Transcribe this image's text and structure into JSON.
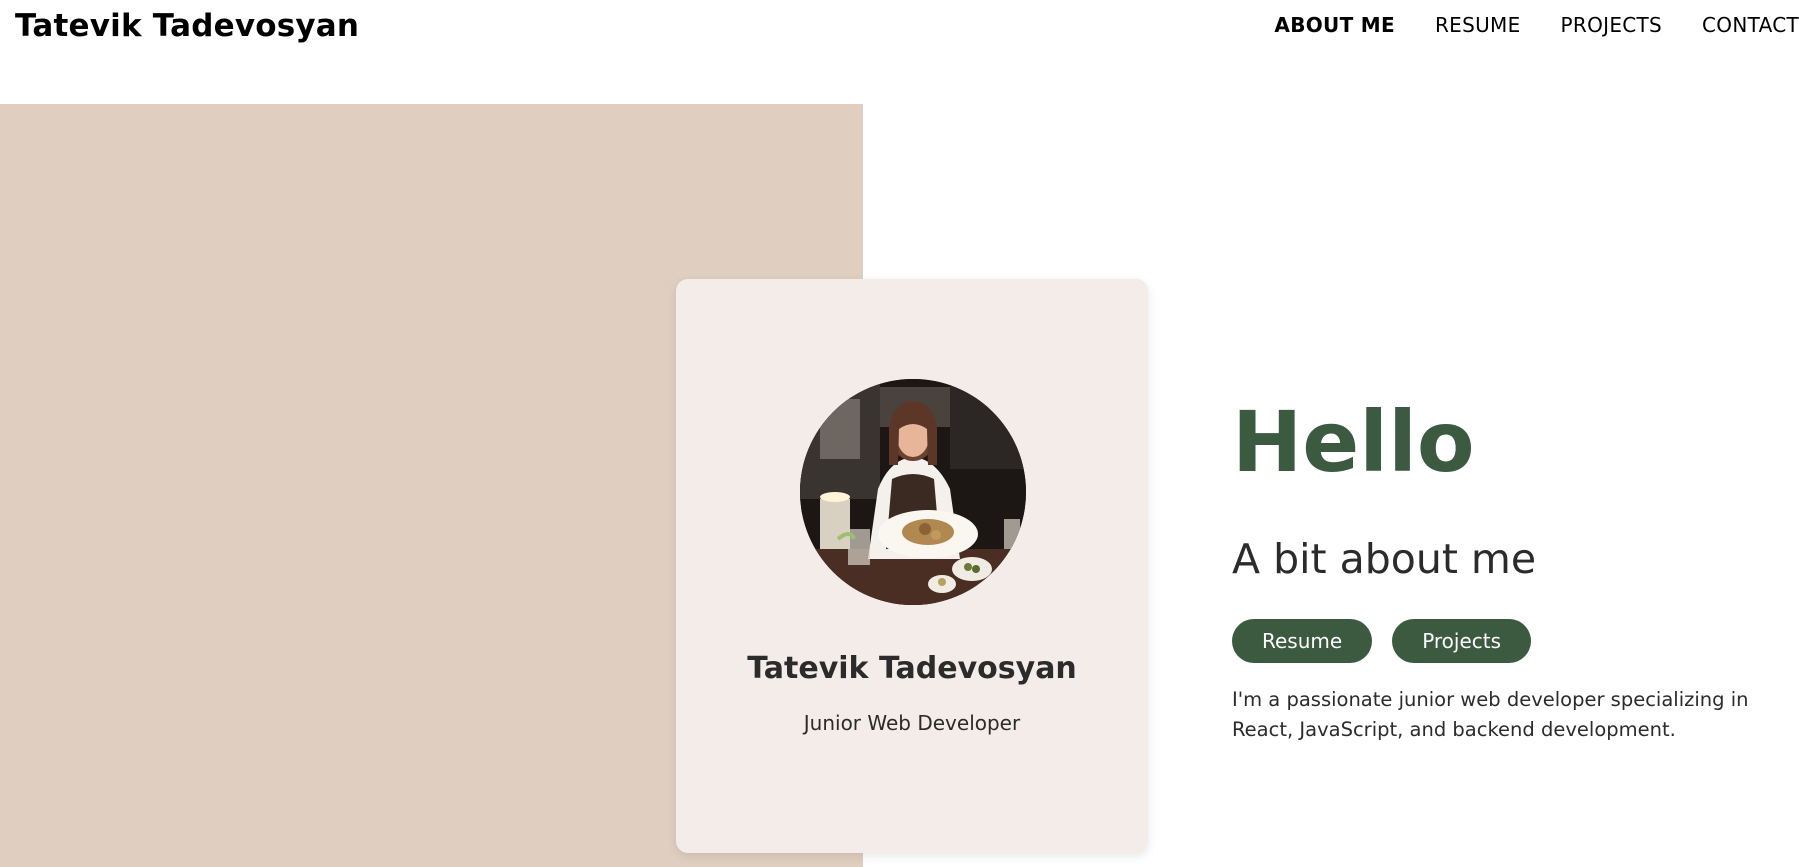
{
  "header": {
    "site_title": "Tatevik Tadevosyan",
    "nav": [
      {
        "label": "ABOUT ME",
        "active": true
      },
      {
        "label": "RESUME",
        "active": false
      },
      {
        "label": "PROJECTS",
        "active": false
      },
      {
        "label": "CONTACT",
        "active": false
      }
    ]
  },
  "profile_card": {
    "name": "Tatevik Tadevosyan",
    "role": "Junior Web Developer",
    "avatar_description": "avatar-photo"
  },
  "intro": {
    "greeting": "Hello",
    "subtitle": "A bit about me",
    "buttons": [
      {
        "label": "Resume"
      },
      {
        "label": "Projects"
      }
    ],
    "bio": "I'm a passionate junior web developer specializing in React, JavaScript, and backend development."
  },
  "colors": {
    "beige_panel": "#e0cfc1",
    "card_background": "#f3ece8",
    "accent_green": "#3b5a40",
    "text_dark": "#2b2b2b"
  }
}
